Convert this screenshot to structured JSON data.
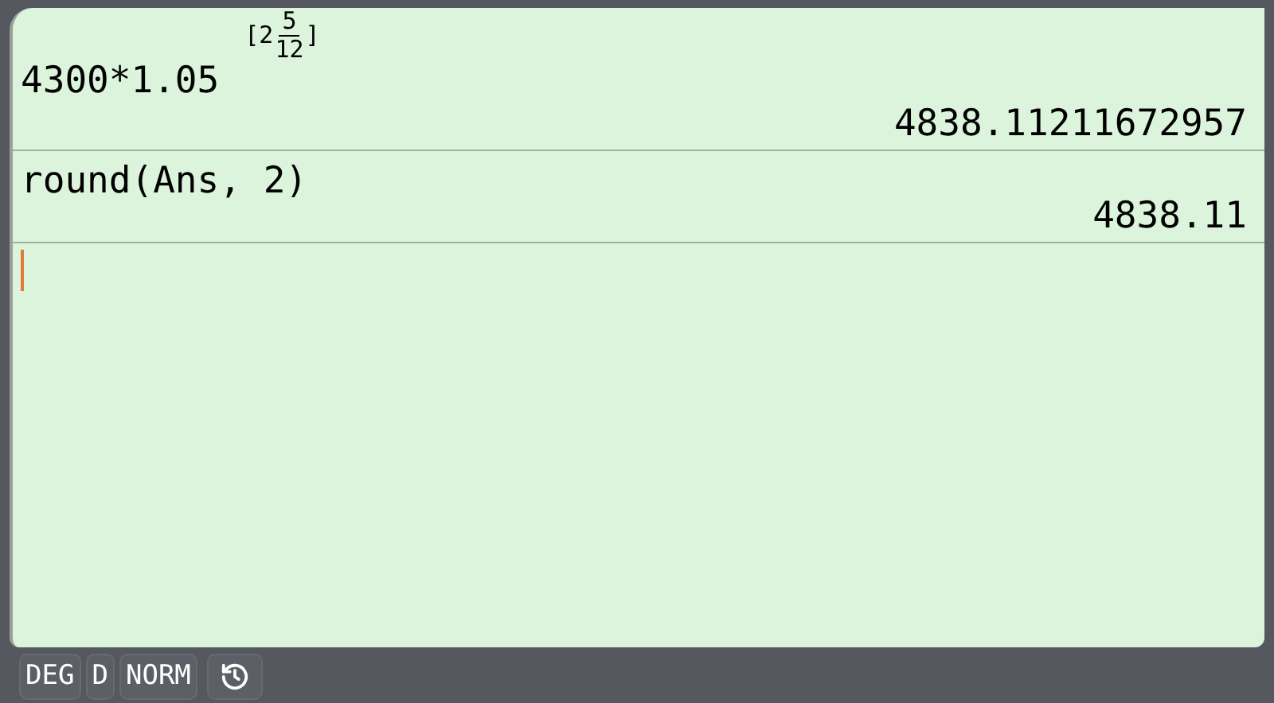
{
  "entries": [
    {
      "kind": "power",
      "base": "4300*1.05",
      "exponent": {
        "open": "[",
        "whole": "2",
        "numerator": "5",
        "denominator": "12",
        "close": "]"
      },
      "result": "4838.11211672957"
    },
    {
      "kind": "plain",
      "expression": "round(Ans, 2)",
      "result": "4838.11"
    }
  ],
  "status_bar": {
    "items": [
      "DEG",
      "D",
      "NORM"
    ]
  }
}
